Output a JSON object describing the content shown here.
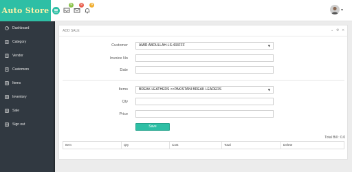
{
  "app": {
    "logo_text": "Auto Store"
  },
  "header": {
    "notifications": [
      {
        "icon": "inbox-icon",
        "count": "9",
        "color": "#8bc34a"
      },
      {
        "icon": "mail-icon",
        "count": "8",
        "color": "#e85b4a"
      },
      {
        "icon": "bell-icon",
        "count": "9",
        "color": "#f0ad2e"
      }
    ],
    "avatar_caret": "▾"
  },
  "sidebar": {
    "items": [
      {
        "label": "Dashboard",
        "icon": "dashboard-icon"
      },
      {
        "label": "Category",
        "icon": "category-icon"
      },
      {
        "label": "Vendor",
        "icon": "vendor-icon"
      },
      {
        "label": "Customers",
        "icon": "customers-icon"
      },
      {
        "label": "Items",
        "icon": "items-icon"
      },
      {
        "label": "Inventory",
        "icon": "inventory-icon"
      },
      {
        "label": "Sale",
        "icon": "sale-icon"
      },
      {
        "label": "Sign out",
        "icon": "sign-out-icon"
      }
    ]
  },
  "panel": {
    "title": "ADD SALE",
    "collapse_glyph": "⌄",
    "settings_glyph": "⚙",
    "close_glyph": "×"
  },
  "form": {
    "customer_label": "Customer",
    "customer_value": "AMIR ABDULLAH-LS-433FFF",
    "invoice_label": "Invoice No",
    "invoice_value": "",
    "date_label": "Date",
    "date_value": "",
    "items_label": "Items",
    "items_value": "BREAK LEATHERS >>PAKISTANI BREAK LEADERS",
    "qty_label": "Qty",
    "qty_value": "",
    "price_label": "Price",
    "price_value": "",
    "select_caret": "▼",
    "save_label": "Save"
  },
  "summary": {
    "total_bill": "Total Bill : 0.0"
  },
  "table": {
    "columns": [
      "Item",
      "Qty",
      "Cost",
      "Total",
      "Delete"
    ]
  }
}
